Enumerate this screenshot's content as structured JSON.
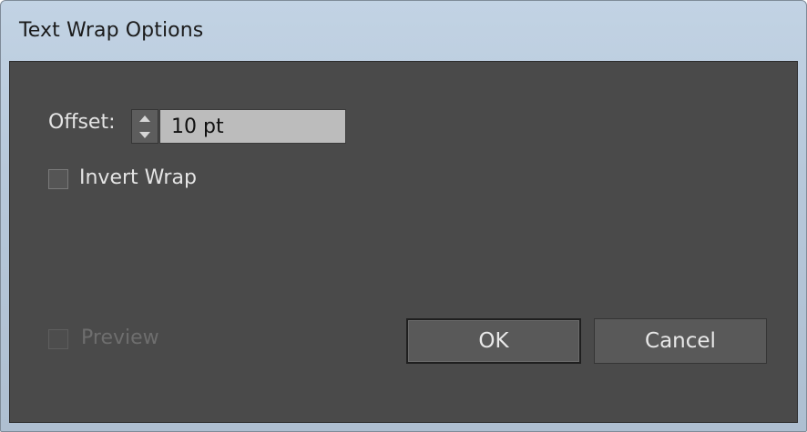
{
  "window": {
    "title": "Text Wrap Options"
  },
  "offset": {
    "label": "Offset:",
    "value": "10 pt"
  },
  "invert_wrap": {
    "label": "Invert Wrap",
    "checked": false
  },
  "preview": {
    "label": "Preview",
    "checked": false,
    "enabled": false
  },
  "buttons": {
    "ok": "OK",
    "cancel": "Cancel"
  },
  "icons": {
    "spinner_up": "triangle-up-icon",
    "spinner_down": "triangle-down-icon"
  },
  "colors": {
    "panel_bg": "#4a4a4a",
    "title_bar": "#b7c8da",
    "input_bg": "#bcbcbc",
    "text": "#e4e4e4"
  }
}
